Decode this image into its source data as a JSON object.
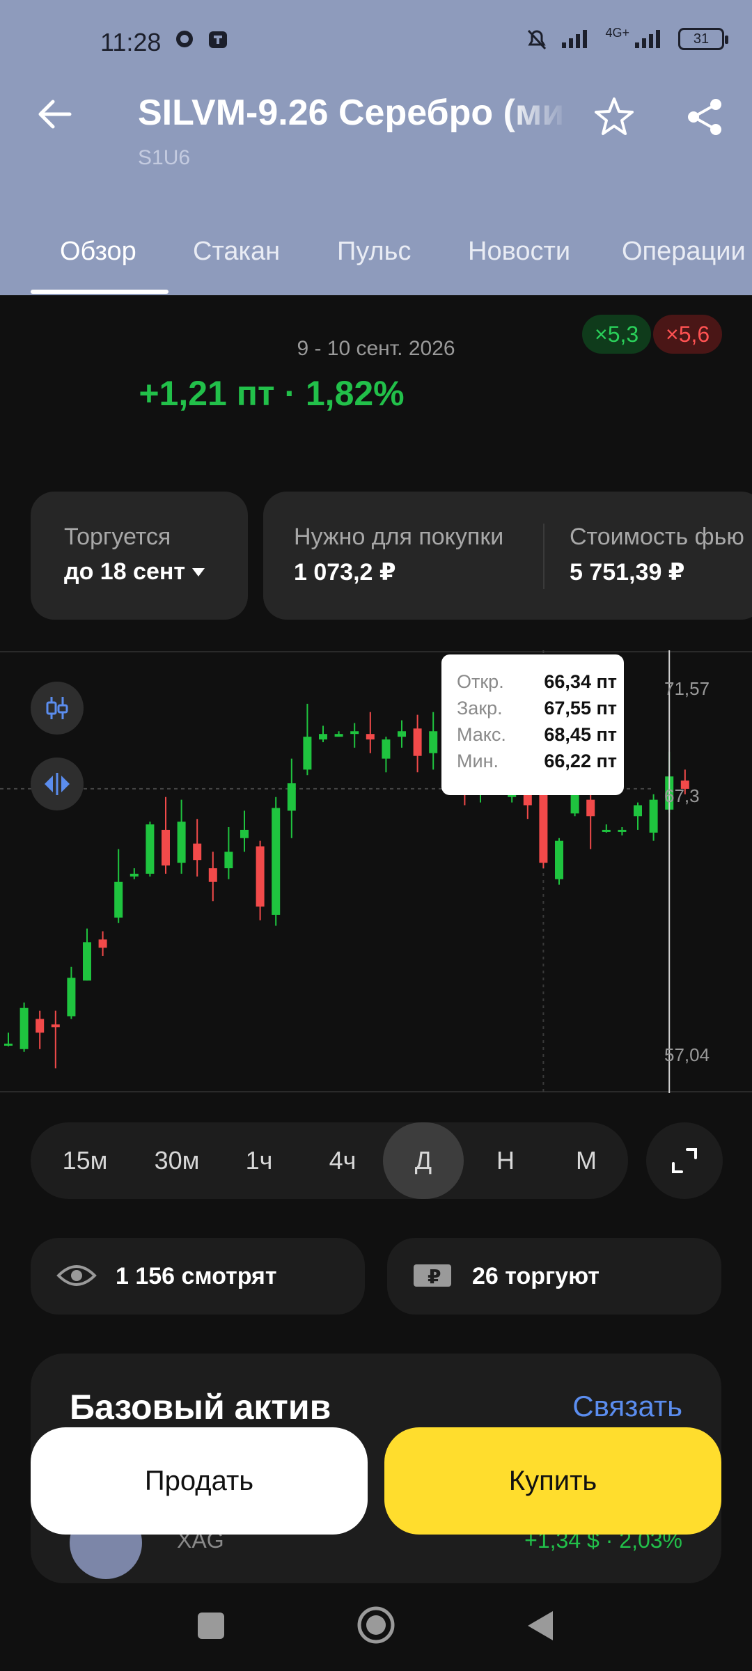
{
  "status_bar": {
    "time": "11:28",
    "network": "4G+",
    "battery": "31"
  },
  "header": {
    "title": "SILVM-9.26 Серебро (ми",
    "ticker": "S1U6"
  },
  "tabs": [
    {
      "label": "Обзор"
    },
    {
      "label": "Стакан"
    },
    {
      "label": "Пульс"
    },
    {
      "label": "Новости"
    },
    {
      "label": "Операции"
    }
  ],
  "summary": {
    "period": "9 - 10 сент. 2026",
    "change": "+1,21 пт · 1,82%",
    "badge_green": "×5,3",
    "badge_red": "×5,6"
  },
  "cards": {
    "trade_label": "Торгуется",
    "trade_value": "до 18 сент",
    "margin_label": "Нужно для покупки",
    "margin_value": "1 073,2 ₽",
    "cost_label": "Стоимость фью",
    "cost_value": "5 751,39 ₽"
  },
  "chart_data": {
    "type": "candlestick",
    "y_ticks": [
      "71,57",
      "67,3",
      "57,04"
    ],
    "ylim": [
      56.4,
      71.9
    ],
    "candles": [
      [
        57.8,
        57.8,
        57.7,
        58.2
      ],
      [
        57.6,
        59.1,
        57.5,
        59.3
      ],
      [
        58.7,
        58.2,
        57.6,
        59.0
      ],
      [
        58.5,
        58.4,
        56.9,
        59.0
      ],
      [
        58.8,
        60.2,
        58.7,
        60.6
      ],
      [
        60.1,
        61.5,
        60.1,
        62.0
      ],
      [
        61.6,
        61.3,
        61.0,
        61.9
      ],
      [
        62.4,
        63.7,
        62.2,
        64.9
      ],
      [
        63.9,
        64.0,
        63.8,
        64.2
      ],
      [
        64.0,
        65.8,
        63.9,
        65.9
      ],
      [
        65.6,
        64.3,
        64.0,
        66.8
      ],
      [
        64.4,
        65.9,
        64.0,
        66.7
      ],
      [
        65.1,
        64.5,
        63.9,
        66.0
      ],
      [
        64.2,
        63.7,
        63.0,
        64.8
      ],
      [
        64.2,
        64.8,
        63.8,
        65.7
      ],
      [
        65.3,
        65.6,
        64.8,
        66.3
      ],
      [
        65.0,
        62.8,
        62.3,
        65.2
      ],
      [
        62.5,
        66.4,
        62.1,
        66.8
      ],
      [
        66.3,
        67.3,
        65.3,
        68.2
      ],
      [
        67.8,
        69.0,
        67.6,
        70.2
      ],
      [
        68.9,
        69.1,
        68.8,
        69.4
      ],
      [
        69.0,
        69.1,
        69.0,
        69.2
      ],
      [
        69.1,
        69.2,
        68.6,
        69.5
      ],
      [
        69.1,
        68.9,
        68.4,
        69.9
      ],
      [
        68.2,
        68.9,
        67.7,
        69.0
      ],
      [
        69.0,
        69.2,
        68.6,
        69.6
      ],
      [
        69.3,
        68.3,
        67.7,
        69.8
      ],
      [
        68.4,
        69.2,
        67.8,
        69.9
      ],
      [
        69.0,
        69.4,
        68.6,
        70.0
      ],
      [
        68.9,
        66.9,
        66.5,
        71.2
      ],
      [
        66.9,
        67.2,
        66.6,
        67.6
      ],
      [
        67.5,
        67.2,
        67.0,
        67.9
      ],
      [
        66.8,
        66.9,
        66.6,
        67.3
      ],
      [
        66.9,
        66.5,
        66.0,
        67.2
      ],
      [
        67.0,
        64.4,
        64.2,
        67.4
      ],
      [
        63.8,
        65.2,
        63.6,
        65.3
      ],
      [
        66.2,
        67.0,
        66.1,
        67.2
      ],
      [
        66.7,
        66.1,
        64.9,
        67.1
      ],
      [
        65.6,
        65.6,
        65.5,
        65.8
      ],
      [
        65.6,
        65.6,
        65.4,
        65.7
      ],
      [
        66.1,
        66.5,
        65.6,
        66.6
      ],
      [
        65.5,
        66.7,
        65.2,
        66.9
      ],
      [
        66.34,
        67.55,
        66.22,
        68.45
      ],
      [
        67.4,
        67.1,
        66.9,
        67.8
      ]
    ],
    "highlighted_index": 42,
    "tooltip": {
      "open_label": "Откр.",
      "open": "66,34 пт",
      "close_label": "Закр.",
      "close": "67,55 пт",
      "high_label": "Макс.",
      "high": "68,45 пт",
      "low_label": "Мин.",
      "low": "66,22 пт"
    },
    "colors": {
      "up": "#1fc43f",
      "down": "#f24a4a"
    }
  },
  "timeframes": [
    {
      "label": "15м"
    },
    {
      "label": "30м"
    },
    {
      "label": "1ч"
    },
    {
      "label": "4ч"
    },
    {
      "label": "Д",
      "active": true
    },
    {
      "label": "Н"
    },
    {
      "label": "М"
    }
  ],
  "stats": {
    "watching": "1 156 смотрят",
    "trading": "26 торгуют"
  },
  "base_asset": {
    "title": "Базовый актив",
    "link": "Связать",
    "ticker": "XAG",
    "change": "+1,34 $ · 2,03%"
  },
  "actions": {
    "sell": "Продать",
    "buy": "Купить"
  },
  "icons": {
    "back": "arrow-left-icon",
    "star": "star-icon",
    "share": "share-icon",
    "candles": "candles-icon",
    "compare": "compare-icon",
    "eye": "eye-icon",
    "ruble_ticket": "ruble-ticket-icon",
    "expand": "expand-icon"
  }
}
